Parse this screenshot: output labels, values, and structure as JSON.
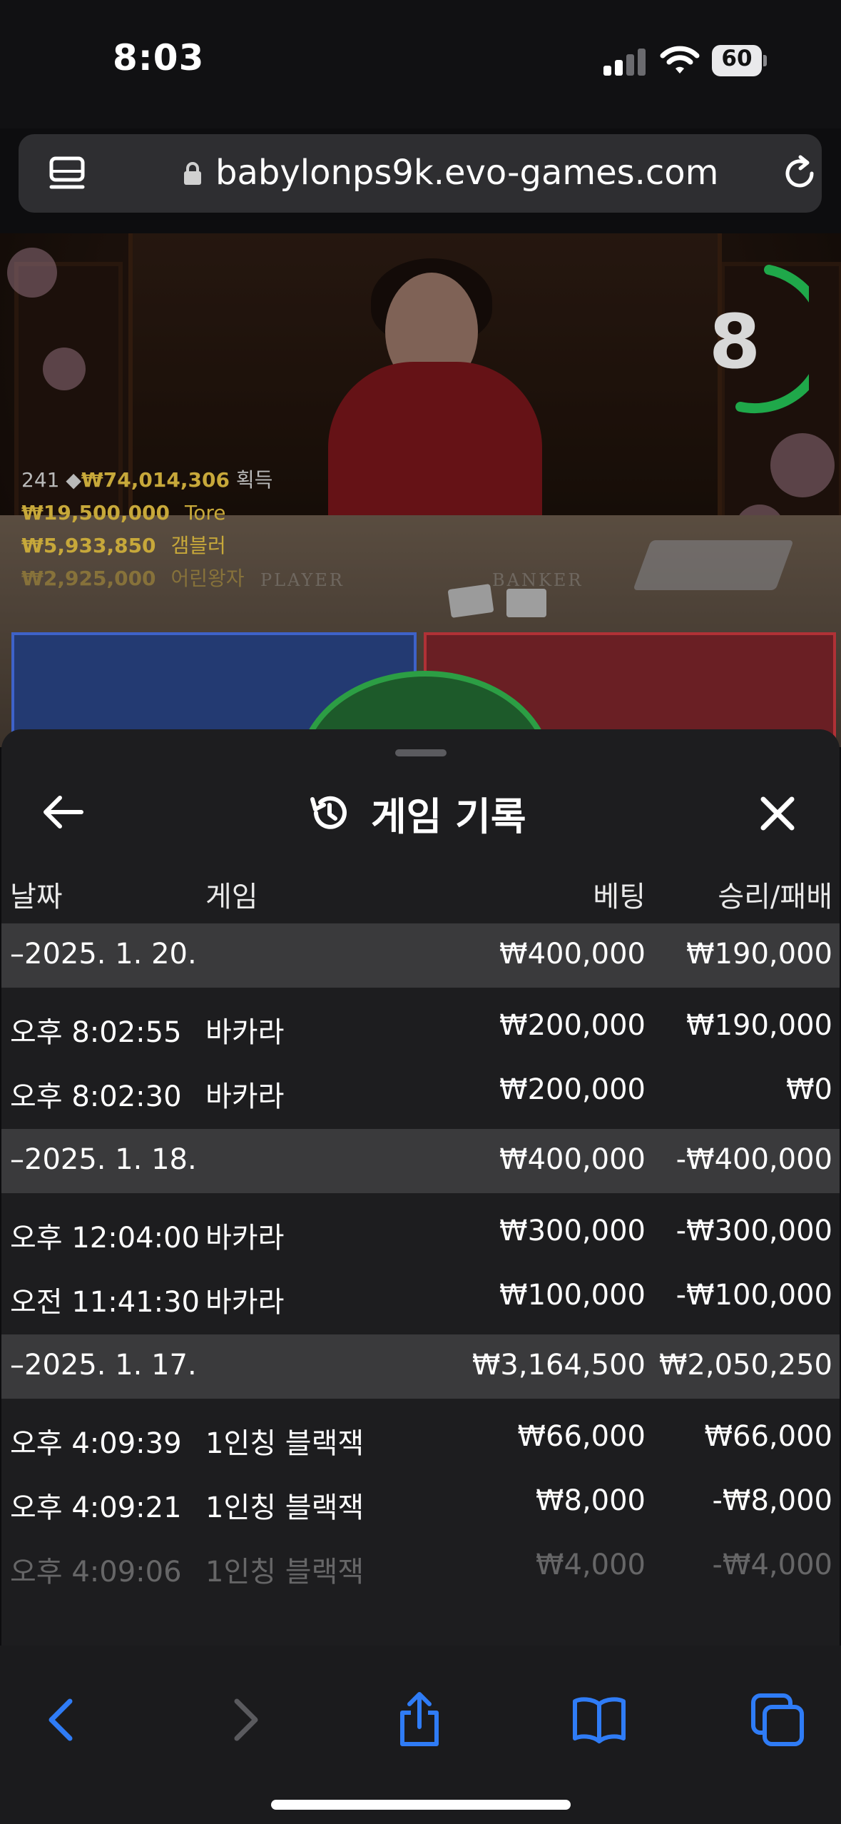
{
  "status_bar": {
    "time": "8:03",
    "battery": "60"
  },
  "browser": {
    "url": "babylonps9k.evo-games.com"
  },
  "video": {
    "timer": "8",
    "table_labels": {
      "player": "PLAYER",
      "banker": "BANKER"
    },
    "stats": {
      "players": "241",
      "total_win": "₩74,014,306",
      "total_win_label": "획득",
      "winners": [
        {
          "amount": "₩19,500,000",
          "name": "Tore"
        },
        {
          "amount": "₩5,933,850",
          "name": "갬블러"
        },
        {
          "amount": "₩2,925,000",
          "name": "어린왕자"
        }
      ]
    }
  },
  "sheet": {
    "title": "게임 기록",
    "columns": {
      "date": "날짜",
      "game": "게임",
      "bet": "베팅",
      "result": "승리/패배"
    },
    "rows": [
      {
        "type": "group",
        "date": "–2025. 1. 20.",
        "game": "",
        "bet": "₩400,000",
        "result": "₩190,000"
      },
      {
        "type": "item",
        "date": "오후 8:02:55",
        "game": "바카라",
        "bet": "₩200,000",
        "result": "₩190,000"
      },
      {
        "type": "item",
        "date": "오후 8:02:30",
        "game": "바카라",
        "bet": "₩200,000",
        "result": "₩0"
      },
      {
        "type": "group",
        "date": "–2025. 1. 18.",
        "game": "",
        "bet": "₩400,000",
        "result": "-₩400,000"
      },
      {
        "type": "item",
        "date": "오후 12:04:00",
        "game": "바카라",
        "bet": "₩300,000",
        "result": "-₩300,000"
      },
      {
        "type": "item",
        "date": "오전 11:41:30",
        "game": "바카라",
        "bet": "₩100,000",
        "result": "-₩100,000"
      },
      {
        "type": "group",
        "date": "–2025. 1. 17.",
        "game": "",
        "bet": "₩3,164,500",
        "result": "₩2,050,250"
      },
      {
        "type": "item",
        "date": "오후 4:09:39",
        "game": "1인칭 블랙잭",
        "bet": "₩66,000",
        "result": "₩66,000"
      },
      {
        "type": "item",
        "date": "오후 4:09:21",
        "game": "1인칭 블랙잭",
        "bet": "₩8,000",
        "result": "-₩8,000"
      },
      {
        "type": "item faded",
        "date": "오후 4:09:06",
        "game": "1인칭 블랙잭",
        "bet": "₩4,000",
        "result": "-₩4,000"
      }
    ]
  },
  "colors": {
    "accent_blue": "#2f7cf6",
    "timer_green": "#1fa84a",
    "gold": "#c7a83a",
    "group_row_bg": "#3a3a3c",
    "sheet_bg": "#1d1d1f"
  },
  "icons": {
    "toolbar": [
      "chevron-left-icon",
      "chevron-right-icon",
      "share-icon",
      "bookmarks-icon",
      "tabs-icon"
    ],
    "sheet": [
      "back-arrow-icon",
      "history-icon",
      "close-icon"
    ]
  }
}
